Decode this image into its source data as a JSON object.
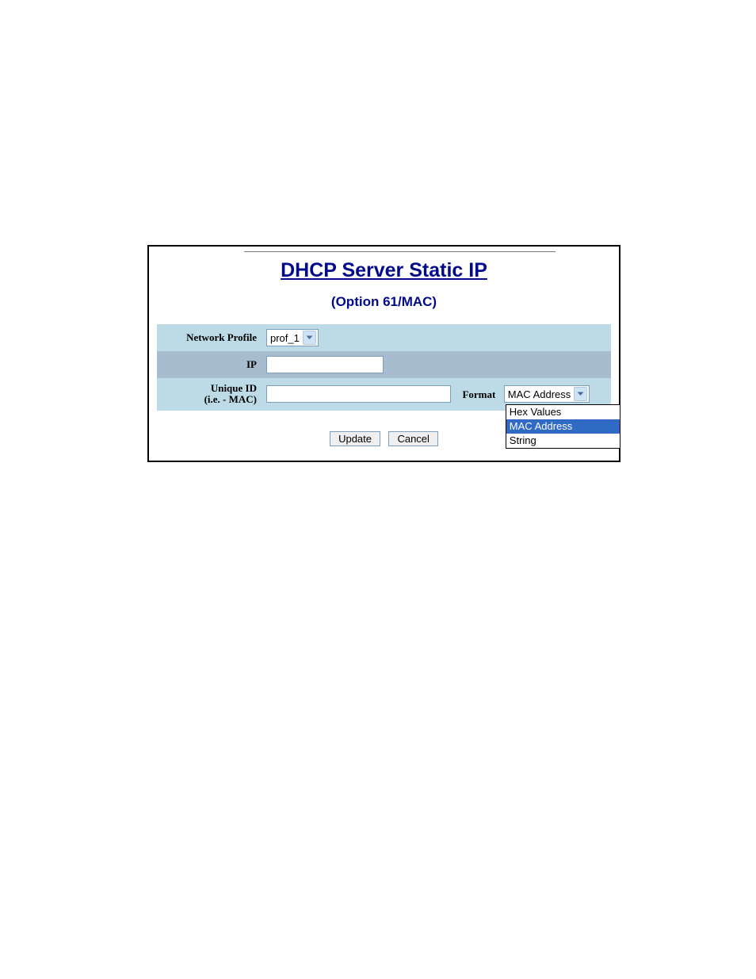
{
  "header": {
    "title": "DHCP Server Static IP",
    "subtitle": "(Option 61/MAC)"
  },
  "rows": {
    "network_profile": {
      "label": "Network Profile",
      "selected": "prof_1"
    },
    "ip": {
      "label": "IP",
      "value": ""
    },
    "unique_id": {
      "label_line1": "Unique ID",
      "label_line2": "(i.e. - MAC)",
      "value": "",
      "format_label": "Format",
      "format_selected": "MAC Address",
      "format_options": [
        "Hex Values",
        "MAC Address",
        "String"
      ]
    }
  },
  "buttons": {
    "update": "Update",
    "cancel": "Cancel"
  }
}
